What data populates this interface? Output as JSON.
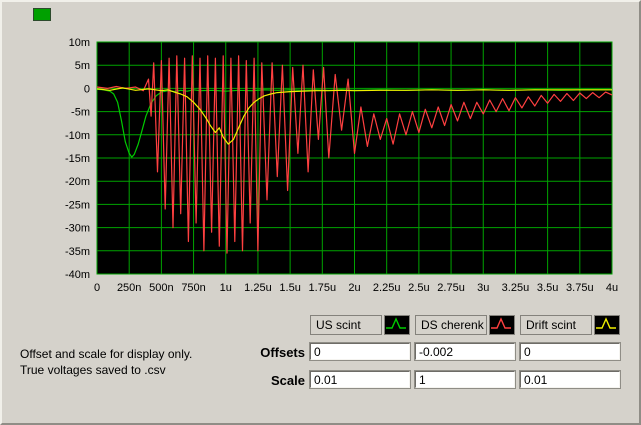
{
  "window": {
    "bg": "#d5d2cb"
  },
  "indicator": {
    "color": "#00a000"
  },
  "note": {
    "line1": "Offset and scale for display only.",
    "line2": "True voltages saved to .csv"
  },
  "controls": {
    "offsets_label": "Offsets",
    "scale_label": "Scale",
    "offsets": [
      "0",
      "-0.002",
      "0"
    ],
    "scales": [
      "0.01",
      "1",
      "0.01"
    ]
  },
  "chart_data": {
    "type": "line",
    "title": "",
    "xlabel": "",
    "ylabel": "",
    "xlim": [
      0,
      4
    ],
    "ylim": [
      -40,
      10
    ],
    "grid": true,
    "plot_bg": "#000000",
    "grid_color": "#00a400",
    "legend_position": "below-right",
    "x_tick_labels": [
      "0",
      "250n",
      "500n",
      "750n",
      "1u",
      "1.25u",
      "1.5u",
      "1.75u",
      "2u",
      "2.25u",
      "2.5u",
      "2.75u",
      "3u",
      "3.25u",
      "3.5u",
      "3.75u",
      "4u"
    ],
    "y_tick_labels": [
      "10m",
      "5m",
      "0",
      "-5m",
      "-10m",
      "-15m",
      "-20m",
      "-25m",
      "-30m",
      "-35m",
      "-40m"
    ],
    "series": [
      {
        "name": "US scint",
        "color": "#00cc00",
        "points": [
          [
            0,
            -0.2
          ],
          [
            0.05,
            -0.3
          ],
          [
            0.1,
            -0.6
          ],
          [
            0.13,
            -1.2
          ],
          [
            0.16,
            -3
          ],
          [
            0.19,
            -7
          ],
          [
            0.22,
            -11.5
          ],
          [
            0.25,
            -14
          ],
          [
            0.27,
            -14.8
          ],
          [
            0.29,
            -14.2
          ],
          [
            0.32,
            -12
          ],
          [
            0.35,
            -9
          ],
          [
            0.38,
            -6
          ],
          [
            0.42,
            -3.2
          ],
          [
            0.46,
            -1.6
          ],
          [
            0.5,
            -0.8
          ],
          [
            0.55,
            -0.5
          ],
          [
            0.6,
            -0.7
          ],
          [
            0.65,
            -0.4
          ],
          [
            0.7,
            -0.6
          ],
          [
            0.75,
            -0.3
          ],
          [
            0.8,
            -0.5
          ],
          [
            0.9,
            -0.4
          ],
          [
            1.0,
            -0.6
          ],
          [
            1.1,
            -0.4
          ],
          [
            1.2,
            -0.5
          ],
          [
            1.3,
            -0.3
          ],
          [
            1.4,
            -0.4
          ],
          [
            1.5,
            -0.3
          ],
          [
            1.6,
            -0.4
          ],
          [
            1.7,
            -0.3
          ],
          [
            1.8,
            -0.4
          ],
          [
            1.9,
            -0.3
          ],
          [
            2.0,
            -0.4
          ],
          [
            2.2,
            -0.3
          ],
          [
            2.4,
            -0.4
          ],
          [
            2.6,
            -0.3
          ],
          [
            2.8,
            -0.4
          ],
          [
            3.0,
            -0.3
          ],
          [
            3.2,
            -0.4
          ],
          [
            3.4,
            -0.3
          ],
          [
            3.6,
            -0.4
          ],
          [
            3.8,
            -0.3
          ],
          [
            4.0,
            -0.3
          ]
        ]
      },
      {
        "name": "DS cherenk",
        "color": "#ff4040",
        "points": [
          [
            0,
            0.3
          ],
          [
            0.08,
            0
          ],
          [
            0.15,
            0.4
          ],
          [
            0.22,
            0
          ],
          [
            0.3,
            0.3
          ],
          [
            0.36,
            -0.5
          ],
          [
            0.4,
            2
          ],
          [
            0.42,
            -6
          ],
          [
            0.44,
            5.5
          ],
          [
            0.47,
            -18
          ],
          [
            0.5,
            6
          ],
          [
            0.53,
            -26
          ],
          [
            0.56,
            6.5
          ],
          [
            0.59,
            -30
          ],
          [
            0.62,
            7
          ],
          [
            0.65,
            -27
          ],
          [
            0.68,
            6.5
          ],
          [
            0.71,
            -33
          ],
          [
            0.74,
            7
          ],
          [
            0.77,
            -29
          ],
          [
            0.8,
            6.5
          ],
          [
            0.83,
            -35
          ],
          [
            0.86,
            7
          ],
          [
            0.89,
            -31
          ],
          [
            0.92,
            6.5
          ],
          [
            0.95,
            -34
          ],
          [
            0.98,
            7
          ],
          [
            1.01,
            -35.5
          ],
          [
            1.04,
            6.5
          ],
          [
            1.07,
            -33
          ],
          [
            1.1,
            7
          ],
          [
            1.13,
            -35
          ],
          [
            1.16,
            6
          ],
          [
            1.19,
            -29
          ],
          [
            1.22,
            6.5
          ],
          [
            1.25,
            -35
          ],
          [
            1.28,
            5.5
          ],
          [
            1.32,
            -24
          ],
          [
            1.36,
            5.5
          ],
          [
            1.4,
            -19
          ],
          [
            1.44,
            5
          ],
          [
            1.48,
            -22
          ],
          [
            1.52,
            4.5
          ],
          [
            1.56,
            -14
          ],
          [
            1.6,
            5
          ],
          [
            1.64,
            -18
          ],
          [
            1.68,
            4
          ],
          [
            1.72,
            -11
          ],
          [
            1.76,
            4.5
          ],
          [
            1.8,
            -15
          ],
          [
            1.85,
            3
          ],
          [
            1.9,
            -9
          ],
          [
            1.95,
            2
          ],
          [
            2.0,
            -14
          ],
          [
            2.05,
            -4
          ],
          [
            2.1,
            -12.5
          ],
          [
            2.15,
            -5.5
          ],
          [
            2.2,
            -11
          ],
          [
            2.25,
            -6.5
          ],
          [
            2.3,
            -12
          ],
          [
            2.35,
            -5.5
          ],
          [
            2.4,
            -10
          ],
          [
            2.45,
            -5
          ],
          [
            2.5,
            -9.5
          ],
          [
            2.55,
            -4.5
          ],
          [
            2.6,
            -8.5
          ],
          [
            2.65,
            -4
          ],
          [
            2.7,
            -8
          ],
          [
            2.75,
            -3.5
          ],
          [
            2.8,
            -7
          ],
          [
            2.85,
            -3
          ],
          [
            2.9,
            -6.5
          ],
          [
            2.95,
            -3
          ],
          [
            3.0,
            -5.5
          ],
          [
            3.05,
            -2.5
          ],
          [
            3.1,
            -5
          ],
          [
            3.15,
            -2.2
          ],
          [
            3.2,
            -4.8
          ],
          [
            3.25,
            -2
          ],
          [
            3.3,
            -4.2
          ],
          [
            3.35,
            -1.8
          ],
          [
            3.4,
            -3.8
          ],
          [
            3.45,
            -1.5
          ],
          [
            3.5,
            -3.2
          ],
          [
            3.55,
            -1.3
          ],
          [
            3.6,
            -2.8
          ],
          [
            3.65,
            -1.1
          ],
          [
            3.7,
            -2.6
          ],
          [
            3.75,
            -1
          ],
          [
            3.8,
            -2.2
          ],
          [
            3.85,
            -0.9
          ],
          [
            3.9,
            -2
          ],
          [
            3.95,
            -0.8
          ],
          [
            4.0,
            -1.4
          ]
        ]
      },
      {
        "name": "Drift scint",
        "color": "#f0f000",
        "points": [
          [
            0,
            -0.1
          ],
          [
            0.1,
            -0.4
          ],
          [
            0.2,
            0.1
          ],
          [
            0.3,
            -0.4
          ],
          [
            0.4,
            -0.1
          ],
          [
            0.5,
            -0.5
          ],
          [
            0.55,
            -0.3
          ],
          [
            0.6,
            -0.8
          ],
          [
            0.65,
            -1.2
          ],
          [
            0.7,
            -1.8
          ],
          [
            0.75,
            -3
          ],
          [
            0.8,
            -4.5
          ],
          [
            0.85,
            -6.5
          ],
          [
            0.88,
            -8
          ],
          [
            0.92,
            -9.5
          ],
          [
            0.95,
            -8.5
          ],
          [
            0.98,
            -10.5
          ],
          [
            1.02,
            -12
          ],
          [
            1.06,
            -11
          ],
          [
            1.1,
            -8.5
          ],
          [
            1.14,
            -6
          ],
          [
            1.18,
            -4.2
          ],
          [
            1.22,
            -3
          ],
          [
            1.26,
            -2.2
          ],
          [
            1.3,
            -1.6
          ],
          [
            1.35,
            -1.2
          ],
          [
            1.4,
            -0.9
          ],
          [
            1.5,
            -0.7
          ],
          [
            1.6,
            -0.6
          ],
          [
            1.7,
            -0.5
          ],
          [
            1.8,
            -0.5
          ],
          [
            1.9,
            -0.4
          ],
          [
            2.0,
            -0.5
          ],
          [
            2.2,
            -0.4
          ],
          [
            2.4,
            -0.4
          ],
          [
            2.6,
            -0.3
          ],
          [
            2.8,
            -0.4
          ],
          [
            3.0,
            -0.3
          ],
          [
            3.2,
            -0.4
          ],
          [
            3.4,
            -0.3
          ],
          [
            3.6,
            -0.3
          ],
          [
            3.8,
            -0.3
          ],
          [
            4.0,
            -0.3
          ]
        ]
      }
    ]
  }
}
